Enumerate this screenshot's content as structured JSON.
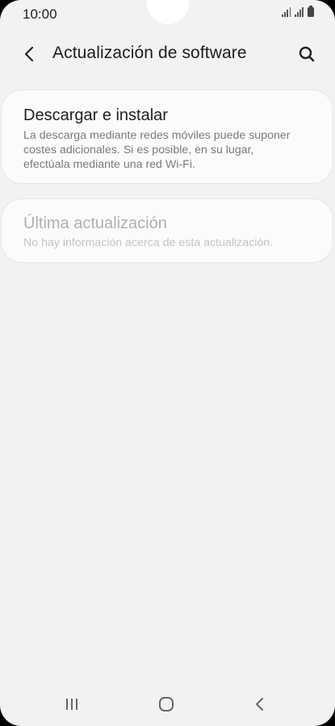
{
  "status_bar": {
    "time": "10:00"
  },
  "app_bar": {
    "title": "Actualización de software"
  },
  "items": [
    {
      "title": "Descargar e instalar",
      "description": "La descarga mediante redes móviles puede suponer costes adicionales. Si es posible, en su lugar, efectúala mediante una red Wi-Fi.",
      "enabled": true
    },
    {
      "title": "Última actualización",
      "description": "No hay información acerca de esta actualización.",
      "enabled": false
    }
  ],
  "icons": {
    "back": "chevron-left-icon",
    "search": "search-icon",
    "nav_recent": "recent-apps-icon",
    "nav_home": "home-icon",
    "nav_back": "back-icon"
  },
  "colors": {
    "background": "#f2f2f2",
    "card": "#fbfbfb",
    "title_text": "#1d1d1d",
    "disabled_text": "#b0b0b0"
  }
}
